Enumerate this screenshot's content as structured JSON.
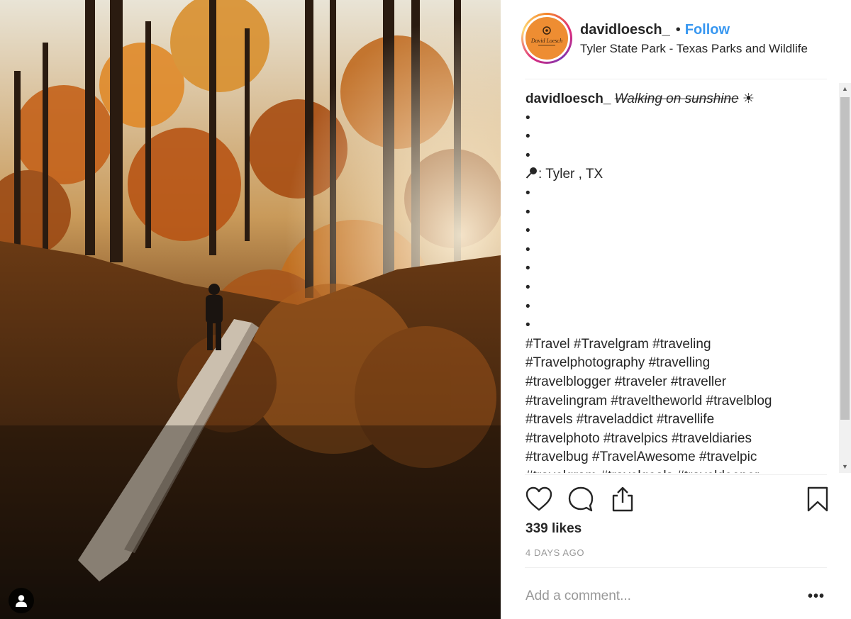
{
  "post": {
    "username": "davidloesch_",
    "separator": "•",
    "follow_label": "Follow",
    "location": "Tyler State Park - Texas Parks and Wildlife",
    "avatar_text": "David Loesch"
  },
  "caption": {
    "username": "davidloesch_",
    "title_struck": "Walking on sunshine",
    "title_emoji": "☀",
    "bullet": "•",
    "location_line": ": Tyler , TX",
    "location_icon": "pin-icon",
    "hashtag_lines": [
      "#Travel #Travelgram #traveling",
      "#Travelphotography #travelling",
      "#travelblogger #traveler #traveller",
      "#travelingram #traveltheworld #travelblog",
      "#travels #traveladdict #travellife",
      "#travelphoto #travelpics #traveldiaries",
      "#travelbug #TravelAwesome #travelpic",
      "#travelgram #travelgoals #traveldeeper"
    ]
  },
  "actions": {
    "like_icon": "heart-icon",
    "comment_icon": "comment-icon",
    "share_icon": "share-icon",
    "save_icon": "bookmark-icon"
  },
  "likes": "339 likes",
  "timestamp": "4 DAYS AGO",
  "comment": {
    "placeholder": "Add a comment...",
    "more_label": "•••"
  },
  "colors": {
    "link_blue": "#3897f0",
    "text": "#262626",
    "muted": "#999999",
    "avatar_bg": "#ee8d32"
  }
}
